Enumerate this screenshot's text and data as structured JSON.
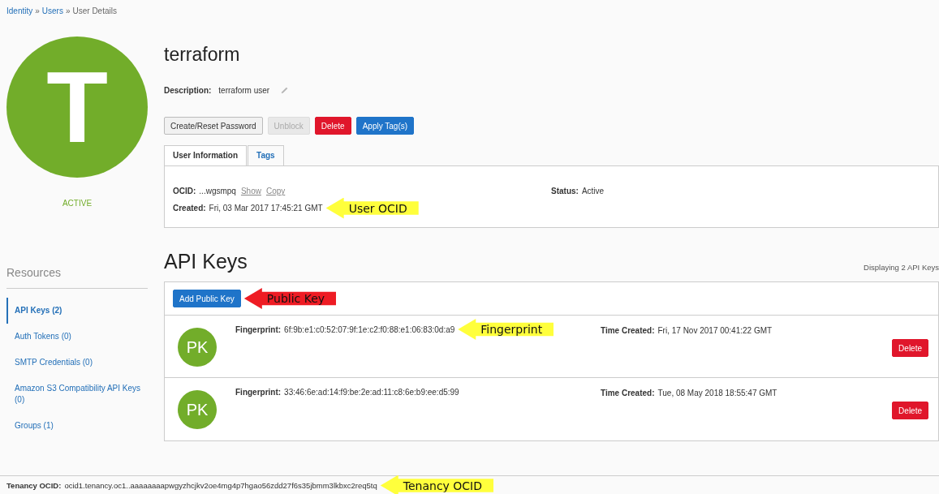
{
  "breadcrumb": [
    {
      "kind": "link",
      "label": "Identity"
    },
    {
      "kind": "separator",
      "label": "»"
    },
    {
      "kind": "link",
      "label": "Users"
    },
    {
      "kind": "separator",
      "label": "»"
    },
    {
      "kind": "current",
      "label": "User Details"
    }
  ],
  "avatar": {
    "initial": "T",
    "status": "ACTIVE"
  },
  "user": {
    "name": "terraform",
    "description_label": "Description:",
    "description": "terraform user"
  },
  "actions": [
    {
      "label": "Create/Reset Password",
      "kind": "default",
      "disabled": false
    },
    {
      "label": "Unblock",
      "kind": "default",
      "disabled": true
    },
    {
      "label": "Delete",
      "kind": "danger",
      "disabled": false
    },
    {
      "label": "Apply Tag(s)",
      "kind": "primary",
      "disabled": false
    }
  ],
  "tabs": [
    {
      "label": "User Information",
      "selected": true
    },
    {
      "label": "Tags",
      "selected": false
    }
  ],
  "user_info": {
    "callout": {
      "text": "User OCID",
      "color": "#ffff3c"
    },
    "ocid_label": "OCID:",
    "ocid": "...wgsmpq",
    "show_link": "Show",
    "copy_link": "Copy",
    "created_label": "Created:",
    "created": "Fri, 03 Mar 2017 17:45:21 GMT",
    "status_label": "Status:",
    "status": "Active"
  },
  "sidebar": {
    "title": "Resources",
    "items": [
      {
        "label": "API Keys (2)",
        "selected": true
      },
      {
        "label": "Auth Tokens (0)",
        "selected": false
      },
      {
        "label": "SMTP Credentials (0)",
        "selected": false
      },
      {
        "label": "Amazon S3 Compatibility API Keys (0)",
        "selected": false
      },
      {
        "label": "Groups (1)",
        "selected": false
      }
    ]
  },
  "api_keys": {
    "callout": {
      "text": "Public Key",
      "color": "#ee1c24"
    },
    "title": "API Keys",
    "count_text": "Displaying 2 API Keys",
    "add_button": "Add Public Key",
    "keys": [
      {
        "callout": {
          "text": "Fingerprint",
          "color": "#ffff3c"
        },
        "initials": "PK",
        "fingerprint_label": "Fingerprint:",
        "fingerprint": "6f:9b:e1:c0:52:07:9f:1e:c2:f0:88:e1:06:83:0d:a9",
        "time_label": "Time Created:",
        "time": "Fri, 17 Nov 2017 00:41:22 GMT",
        "delete_button": "Delete"
      },
      {
        "initials": "PK",
        "fingerprint_label": "Fingerprint:",
        "fingerprint": "33:46:6e:ad:14:f9:be:2e:ad:11:c8:6e:b9:ee:d5:99",
        "time_label": "Time Created:",
        "time": "Tue, 08 May 2018 18:55:47 GMT",
        "delete_button": "Delete"
      }
    ]
  },
  "footer": {
    "callout": {
      "text": "Tenancy OCID",
      "color": "#ffff3c"
    },
    "label": "Tenancy OCID:",
    "value": "ocid1.tenancy.oc1..aaaaaaaapwgyzhcjkv2oe4mg4p7hgao56zdd27f6s35jbmm3lkbxc2req5tq"
  }
}
